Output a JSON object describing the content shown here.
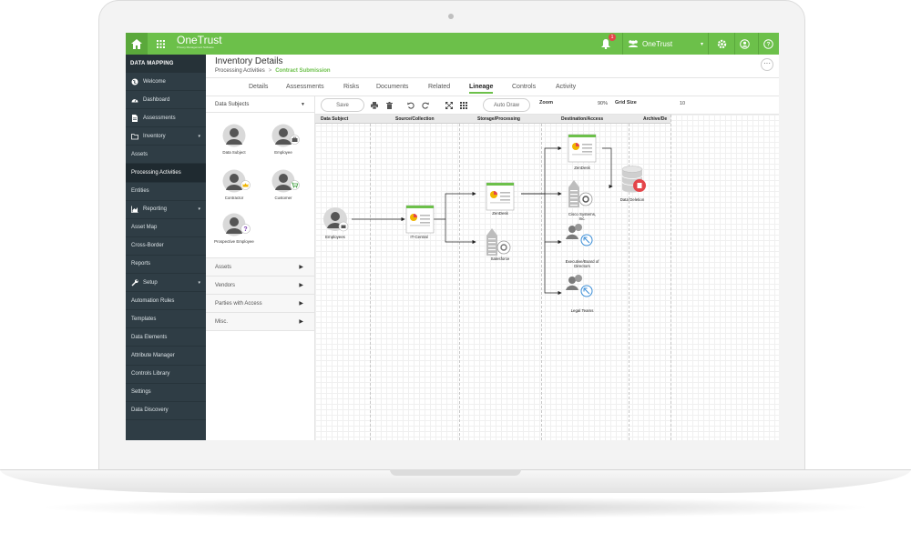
{
  "topbar": {
    "brand_name": "OneTrust",
    "brand_tagline": "Privacy Management Software",
    "notification_count": "1",
    "org_name": "OneTrust",
    "accent_color": "#6cc04a"
  },
  "sidebar": {
    "title": "DATA MAPPING",
    "items": [
      {
        "label": "Welcome",
        "icon": "globe-icon",
        "level": "top"
      },
      {
        "label": "Dashboard",
        "icon": "dashboard-icon",
        "level": "top"
      },
      {
        "label": "Assessments",
        "icon": "document-icon",
        "level": "top"
      },
      {
        "label": "Inventory",
        "icon": "folder-icon",
        "level": "top",
        "expandable": true
      },
      {
        "label": "Assets",
        "level": "sub"
      },
      {
        "label": "Processing Activities",
        "level": "sub",
        "active": true
      },
      {
        "label": "Entities",
        "level": "sub"
      },
      {
        "label": "Reporting",
        "icon": "chart-icon",
        "level": "top",
        "expandable": true
      },
      {
        "label": "Asset Map",
        "level": "sub"
      },
      {
        "label": "Cross-Border",
        "level": "sub"
      },
      {
        "label": "Reports",
        "level": "sub"
      },
      {
        "label": "Setup",
        "icon": "wrench-icon",
        "level": "top",
        "expandable": true
      },
      {
        "label": "Automation Rules",
        "level": "sub"
      },
      {
        "label": "Templates",
        "level": "sub"
      },
      {
        "label": "Data Elements",
        "level": "sub"
      },
      {
        "label": "Attribute Manager",
        "level": "sub"
      },
      {
        "label": "Controls Library",
        "level": "sub"
      },
      {
        "label": "Settings",
        "level": "sub"
      },
      {
        "label": "Data Discovery",
        "level": "sub"
      }
    ]
  },
  "header": {
    "title": "Inventory Details",
    "breadcrumb_parent": "Processing Activities",
    "breadcrumb_separator": ">",
    "breadcrumb_current": "Contract Submission",
    "more_label": "···"
  },
  "tabs": [
    "Details",
    "Assessments",
    "Risks",
    "Documents",
    "Related",
    "Lineage",
    "Controls",
    "Activity"
  ],
  "active_tab": "Lineage",
  "left_panel": {
    "dropdown_label": "Data Subjects",
    "palette": [
      {
        "label": "Data Subject",
        "badge": ""
      },
      {
        "label": "Employee",
        "badge": "briefcase-icon"
      },
      {
        "label": "Contractor",
        "badge": "crown-icon"
      },
      {
        "label": "Customer",
        "badge": "cart-icon"
      },
      {
        "label": "Prospective Employee",
        "badge": "question-icon"
      }
    ],
    "sections": [
      "Assets",
      "Vendors",
      "Parties with Access",
      "Misc."
    ]
  },
  "toolbar": {
    "save_label": "Save",
    "auto_draw_label": "Auto Draw",
    "zoom_label": "Zoom",
    "zoom_value": "90%",
    "grid_label": "Grid Size",
    "grid_value": "10"
  },
  "canvas": {
    "lanes": [
      "Data Subject",
      "Source/Collection",
      "Storage/Processing",
      "Destination/Access",
      "Archive/De"
    ],
    "nodes": [
      {
        "label": "Employees"
      },
      {
        "label": "IT-Central"
      },
      {
        "label": "ZenDesk"
      },
      {
        "label": "Salesforce"
      },
      {
        "label": "ZenDesk"
      },
      {
        "label": "Cisco Systems,",
        "label2": "Inc."
      },
      {
        "label": "Executive/Board of",
        "label2": "Directors"
      },
      {
        "label": "Legal Teams"
      },
      {
        "label": "Data Deletion"
      }
    ]
  }
}
